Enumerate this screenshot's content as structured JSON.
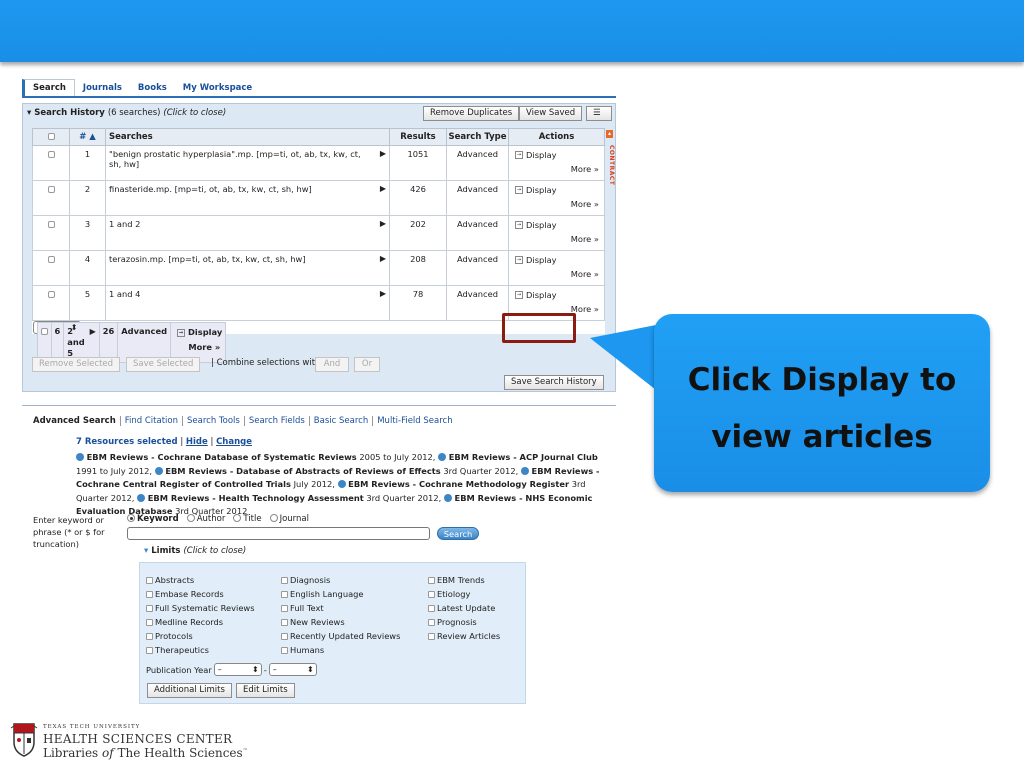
{
  "tabs": [
    "Search",
    "Journals",
    "Books",
    "My Workspace"
  ],
  "search_history": {
    "title": "Search History",
    "count": "(6 searches)",
    "toggle": "(Click to close)",
    "remove_duplicates": "Remove Duplicates",
    "view_saved": "View Saved",
    "columns": {
      "num": "# ▲",
      "searches": "Searches",
      "results": "Results",
      "type": "Search Type",
      "actions": "Actions"
    },
    "rows": [
      {
        "num": "1",
        "query": "\"benign prostatic hyperplasia\".mp. [mp=ti, ot, ab, tx, kw, ct, sh, hw]",
        "results": "1051",
        "type": "Advanced"
      },
      {
        "num": "2",
        "query": "finasteride.mp. [mp=ti, ot, ab, tx, kw, ct, sh, hw]",
        "results": "426",
        "type": "Advanced"
      },
      {
        "num": "3",
        "query": "1 and 2",
        "results": "202",
        "type": "Advanced"
      },
      {
        "num": "4",
        "query": "terazosin.mp. [mp=ti, ot, ab, tx, kw, ct, sh, hw]",
        "results": "208",
        "type": "Advanced"
      },
      {
        "num": "5",
        "query": "1 and 4",
        "results": "78",
        "type": "Advanced"
      },
      {
        "num": "6",
        "query": "2 and 5",
        "results": "26",
        "type": "Advanced"
      }
    ],
    "display_label": "Display",
    "more_label": "More »",
    "contract_label": "CONTRACT",
    "remove_selected": "Remove Selected",
    "save_selected": "Save Selected",
    "combine_label": "| Combine selections with:",
    "and_label": "And",
    "or_label": "Or",
    "save_history": "Save Search History"
  },
  "adv_links": [
    "Advanced Search",
    "Find Citation",
    "Search Tools",
    "Search Fields",
    "Basic Search",
    "Multi-Field Search"
  ],
  "resources": {
    "selected": "7 Resources selected",
    "hide": "Hide",
    "change": "Change",
    "items": [
      {
        "name": "EBM Reviews - Cochrane Database of Systematic Reviews",
        "date": "2005 to July 2012,"
      },
      {
        "name": "EBM Reviews - ACP Journal Club",
        "date": "1991 to July 2012,"
      },
      {
        "name": "EBM Reviews - Database of Abstracts of Reviews of Effects",
        "date": "3rd Quarter 2012,"
      },
      {
        "name": "EBM Reviews - Cochrane Central Register of Controlled Trials",
        "date": "July 2012,"
      },
      {
        "name": "EBM Reviews - Cochrane Methodology Register",
        "date": "3rd Quarter 2012,"
      },
      {
        "name": "EBM Reviews - Health Technology Assessment",
        "date": "3rd Quarter 2012,"
      },
      {
        "name": "EBM Reviews - NHS Economic Evaluation Database",
        "date": "3rd Quarter 2012"
      }
    ]
  },
  "search_form": {
    "label": "Enter keyword or phrase (* or $ for truncation)",
    "options": [
      "Keyword",
      "Author",
      "Title",
      "Journal"
    ],
    "search_button": "Search"
  },
  "limits": {
    "title": "Limits",
    "toggle": "(Click to close)",
    "col1": [
      "Abstracts",
      "Embase Records",
      "Full Systematic Reviews",
      "Medline Records",
      "Protocols",
      "Therapeutics"
    ],
    "col2": [
      "Diagnosis",
      "English Language",
      "Full Text",
      "New Reviews",
      "Recently Updated Reviews",
      "Humans"
    ],
    "col3": [
      "EBM Trends",
      "Etiology",
      "Latest Update",
      "Prognosis",
      "Review Articles"
    ],
    "pub_year_label": "Publication Year",
    "pub_year_from": "–",
    "pub_year_to": "–",
    "additional_limits": "Additional Limits",
    "edit_limits": "Edit Limits"
  },
  "callout": {
    "line1": "Click Display to",
    "line2": "view articles"
  },
  "footer": {
    "line1": "TEXAS TECH UNIVERSITY",
    "line2": "HEALTH SCIENCES CENTER",
    "line3a": "Libraries ",
    "line3b": "of",
    "line3c": " The Health Sciences",
    "tm": "™"
  }
}
